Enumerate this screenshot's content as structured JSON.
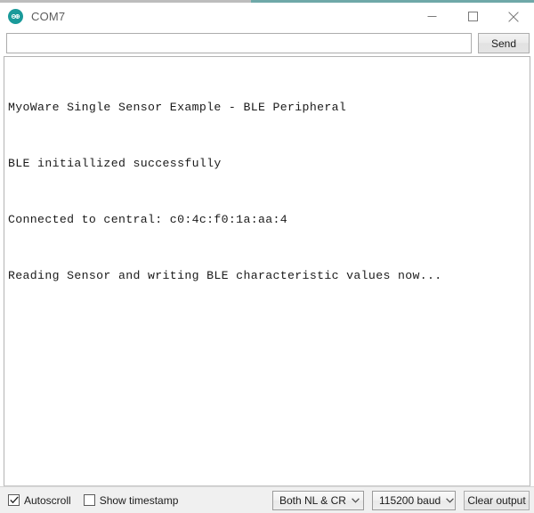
{
  "window": {
    "title": "COM7",
    "app_icon": "arduino-infinity-icon",
    "accent_color_left": "#bdbdbd",
    "accent_color_right": "#6fa8a8",
    "icon_color": "#1a9a9a",
    "controls": {
      "minimize": "minimize-icon",
      "maximize": "maximize-icon",
      "close": "close-icon"
    }
  },
  "send_row": {
    "input_value": "",
    "input_placeholder": "",
    "send_label": "Send"
  },
  "console": {
    "lines": [
      "MyoWare Single Sensor Example - BLE Peripheral",
      "BLE initiallized successfully",
      "Connected to central: c0:4c:f0:1a:aa:4",
      "Reading Sensor and writing BLE characteristic values now..."
    ]
  },
  "bottom_bar": {
    "autoscroll": {
      "label": "Autoscroll",
      "checked": true
    },
    "show_timestamp": {
      "label": "Show timestamp",
      "checked": false
    },
    "line_ending": {
      "selected": "Both NL & CR"
    },
    "baud_rate": {
      "selected": "115200 baud"
    },
    "clear_output_label": "Clear output"
  }
}
